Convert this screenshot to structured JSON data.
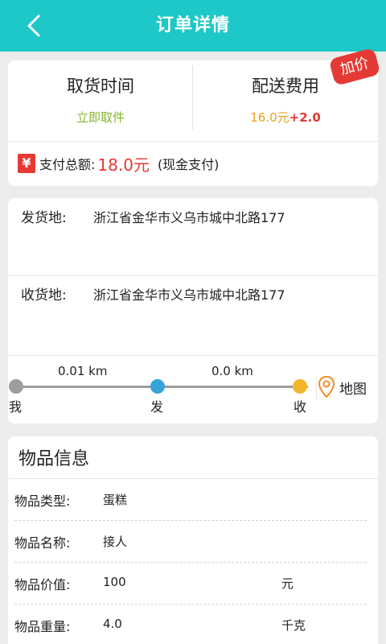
{
  "header": {
    "title": "订单详情"
  },
  "summary": {
    "pickup_label": "取货时间",
    "pickup_value": "立即取件",
    "fee_label": "配送费用",
    "fee_base": "16.0元",
    "fee_extra": "+2.0",
    "badge": "加价",
    "pay_icon": "¥",
    "pay_label": "支付总额:",
    "pay_amount": "18.0元",
    "pay_method": "(现金支付)"
  },
  "address": {
    "from_label": "发货地:",
    "from_value": "浙江省金华市义乌市城中北路177",
    "to_label": "收货地:",
    "to_value": "浙江省金华市义乌市城中北路177",
    "dist_1": "0.01 km",
    "dist_2": "0.0 km",
    "node_me": "我",
    "node_send": "发",
    "node_receive": "收",
    "map_label": "地图"
  },
  "goods": {
    "title": "物品信息",
    "rows": [
      {
        "label": "物品类型:",
        "value": "蛋糕",
        "unit": ""
      },
      {
        "label": "物品名称:",
        "value": "接人",
        "unit": ""
      },
      {
        "label": "物品价值:",
        "value": "100",
        "unit": "元"
      },
      {
        "label": "物品重量:",
        "value": "4.0",
        "unit": "千克"
      }
    ]
  },
  "colors": {
    "header": "#1ec8c8",
    "accent_red": "#e53935",
    "green": "#84b52c",
    "orange": "#e8a21c",
    "blue_dot": "#35a4d8",
    "yellow_dot": "#f2b62b"
  }
}
